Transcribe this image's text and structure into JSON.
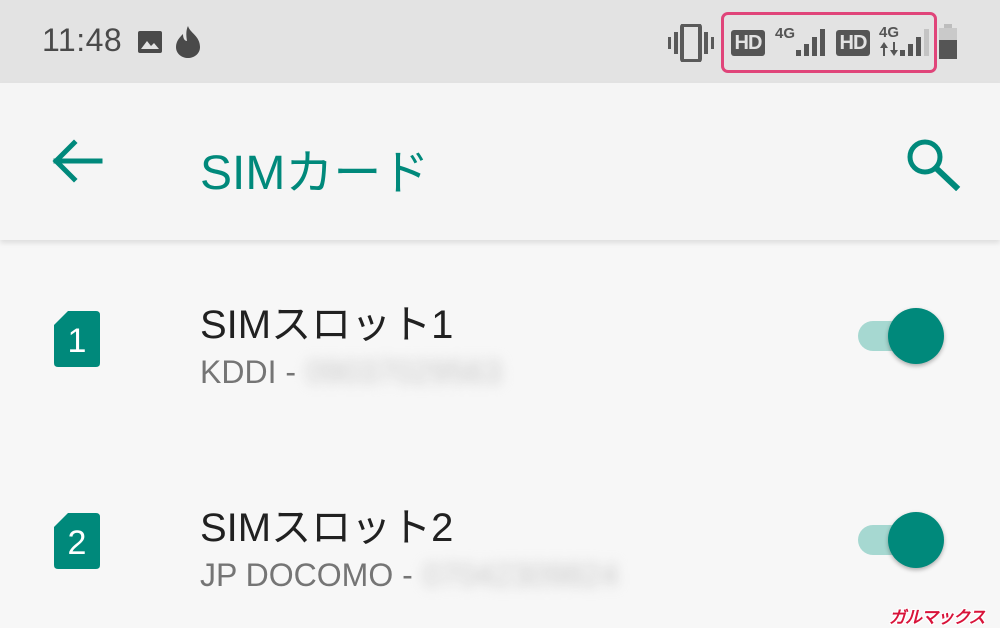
{
  "status_bar": {
    "time": "11:48",
    "icons": [
      "gallery-icon",
      "flame-icon",
      "vibrate-icon",
      "signal-icon",
      "battery-icon"
    ],
    "sim1": {
      "hd": "HD",
      "network": "4G"
    },
    "sim2": {
      "hd": "HD",
      "network": "4G"
    }
  },
  "app_bar": {
    "title": "SIMカード",
    "back_icon": "arrow-back",
    "search_icon": "search"
  },
  "sim_slots": [
    {
      "number": "1",
      "title": "SIMスロット1",
      "carrier": "KDDI -",
      "phone_redacted": "09037029563",
      "enabled": true
    },
    {
      "number": "2",
      "title": "SIMスロット2",
      "carrier": "JP DOCOMO -",
      "phone_redacted": "07042309824",
      "enabled": true
    }
  ],
  "watermark": "ガルマックス",
  "colors": {
    "accent": "#00897b",
    "toggle_track": "#a6d8d1",
    "highlight_border": "#e0457a",
    "status_bar_bg": "#e3e3e3",
    "background": "#f7f7f7"
  }
}
